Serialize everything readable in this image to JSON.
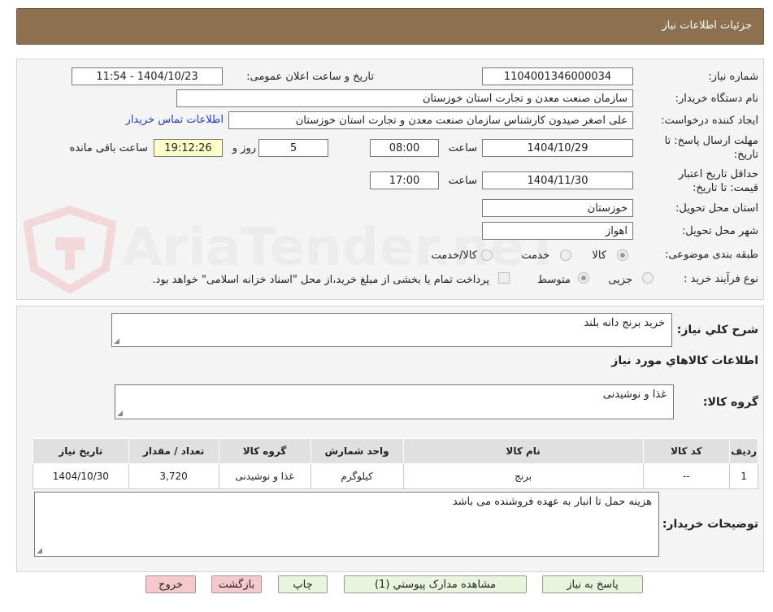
{
  "header": {
    "title": "جزئیات اطلاعات نیاز"
  },
  "watermark": "AriaTender.neT",
  "form": {
    "need_number_label": "شماره نیاز:",
    "need_number": "1104001346000034",
    "announce_label": "تاریخ و ساعت اعلان عمومی:",
    "announce_value": "1404/10/23 - 11:54",
    "buyer_org_label": "نام دستگاه خریدار:",
    "buyer_org": "سازمان صنعت معدن و تجارت استان خوزستان",
    "creator_label": "ایجاد کننده درخواست:",
    "creator": "علی اصغر صیدون کارشناس سازمان صنعت معدن و تجارت استان خوزستان",
    "contact_link": "اطلاعات تماس خریدار",
    "deadline_label_1": "مهلت ارسال پاسخ: تا",
    "deadline_label_2": "تاریخ:",
    "deadline_date": "1404/10/29",
    "time_label": "ساعت",
    "deadline_time": "08:00",
    "days_value": "5",
    "days_label": "روز و",
    "remaining_time": "19:12:26",
    "remaining_label": "ساعت باقی مانده",
    "validity_label_1": "حداقل تاریخ اعتبار",
    "validity_label_2": "قیمت: تا تاریخ:",
    "validity_date": "1404/11/30",
    "validity_time": "17:00",
    "province_label": "استان محل تحویل:",
    "province": "خوزستان",
    "city_label": "شهر محل تحویل:",
    "city": "اهواز",
    "category_label": "طبقه بندی موضوعی:",
    "category_options": [
      "کالا",
      "خدمت",
      "کالا/خدمت"
    ],
    "process_label": "نوع فرآیند خرید :",
    "process_options": [
      "جزیی",
      "متوسط"
    ],
    "payment_note": "پرداخت تمام یا بخشی از مبلغ خرید،از محل \"اسناد خزانه اسلامی\" خواهد بود."
  },
  "summary": {
    "label": "شرح کلي نياز:",
    "value": "خرید برنج دانه بلند",
    "goods_info_title": "اطلاعات کالاهاي مورد نياز",
    "group_label": "گروه کالا:",
    "group_value": "غذا و نوشیدنی"
  },
  "table": {
    "headers": [
      "رديف",
      "کد کالا",
      "نام کالا",
      "واحد شمارش",
      "گروه کالا",
      "تعداد / مقدار",
      "تاریخ نیاز"
    ],
    "rows": [
      [
        "1",
        "--",
        "برنج",
        "کیلوگرم",
        "غذا و نوشیدنی",
        "3,720",
        "1404/10/30"
      ]
    ]
  },
  "buyer_notes": {
    "label": "توضیحات خریدار:",
    "value": "هزینه حمل تا انبار به عهده فروشنده می باشد"
  },
  "buttons": {
    "reply": "پاسخ به نیاز",
    "attachments": "مشاهده مدارک پیوستي (1)",
    "print": "چاپ",
    "back": "بازگشت",
    "exit": "خروج"
  },
  "colors": {
    "header": "#8c7050",
    "button_green": "#e8f5dc",
    "button_red": "#f7c9cc",
    "link": "#1a3cc8",
    "highlight": "#ffffc8"
  }
}
